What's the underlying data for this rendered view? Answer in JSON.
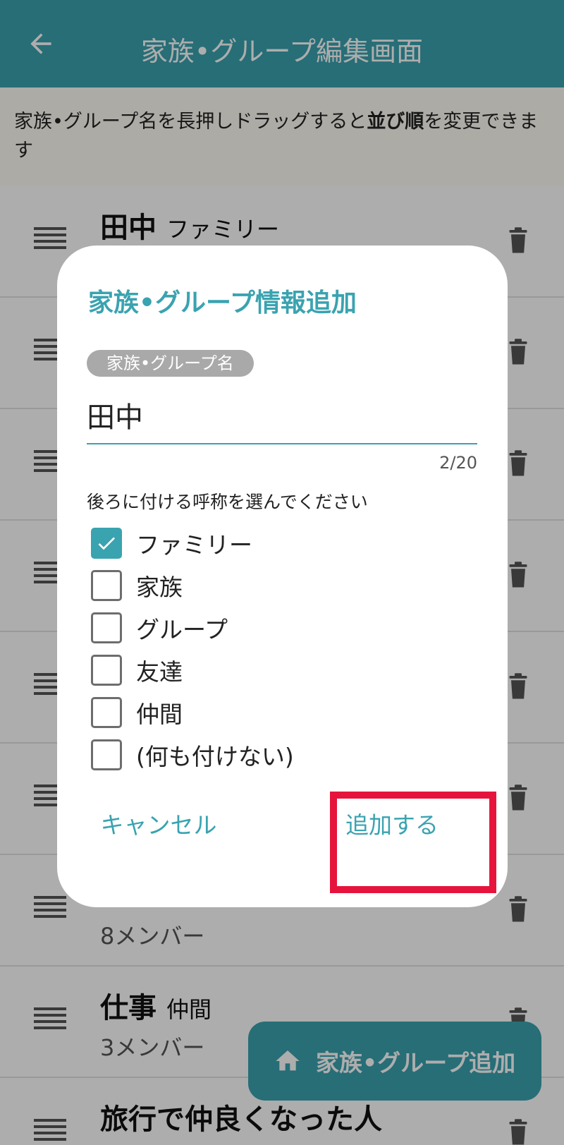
{
  "app_bar": {
    "title": "家族•グループ編集画面",
    "back_icon": "arrow-left-icon"
  },
  "hint": {
    "before": "家族•グループ名を長押しドラッグすると",
    "bold": "並び順",
    "after": "を変更できます"
  },
  "groups": [
    {
      "name": "田中",
      "suffix": "ファミリー",
      "members": ""
    },
    {
      "name": "",
      "suffix": "",
      "members": ""
    },
    {
      "name": "",
      "suffix": "",
      "members": ""
    },
    {
      "name": "",
      "suffix": "",
      "members": ""
    },
    {
      "name": "",
      "suffix": "",
      "members": ""
    },
    {
      "name": "",
      "suffix": "",
      "members": ""
    },
    {
      "name": "",
      "suffix": "",
      "members": "8メンバー"
    },
    {
      "name": "仕事",
      "suffix": "仲間",
      "members": "3メンバー"
    },
    {
      "name": "旅行で仲良くなった人",
      "suffix": "",
      "members": ""
    }
  ],
  "fab": {
    "label": "家族•グループ追加",
    "icon": "home-icon"
  },
  "dialog": {
    "title": "家族•グループ情報追加",
    "field_label": "家族•グループ名",
    "field_value": "田中",
    "counter": "2/20",
    "question": "後ろに付ける呼称を選んでください",
    "options": [
      {
        "label": "ファミリー",
        "checked": true
      },
      {
        "label": "家族",
        "checked": false
      },
      {
        "label": "グループ",
        "checked": false
      },
      {
        "label": "友達",
        "checked": false
      },
      {
        "label": "仲間",
        "checked": false
      },
      {
        "label": "(何も付けない)",
        "checked": false
      }
    ],
    "cancel_label": "キャンセル",
    "add_label": "追加する"
  },
  "colors": {
    "accent": "#3aa3b0",
    "highlight": "#e6143c"
  }
}
